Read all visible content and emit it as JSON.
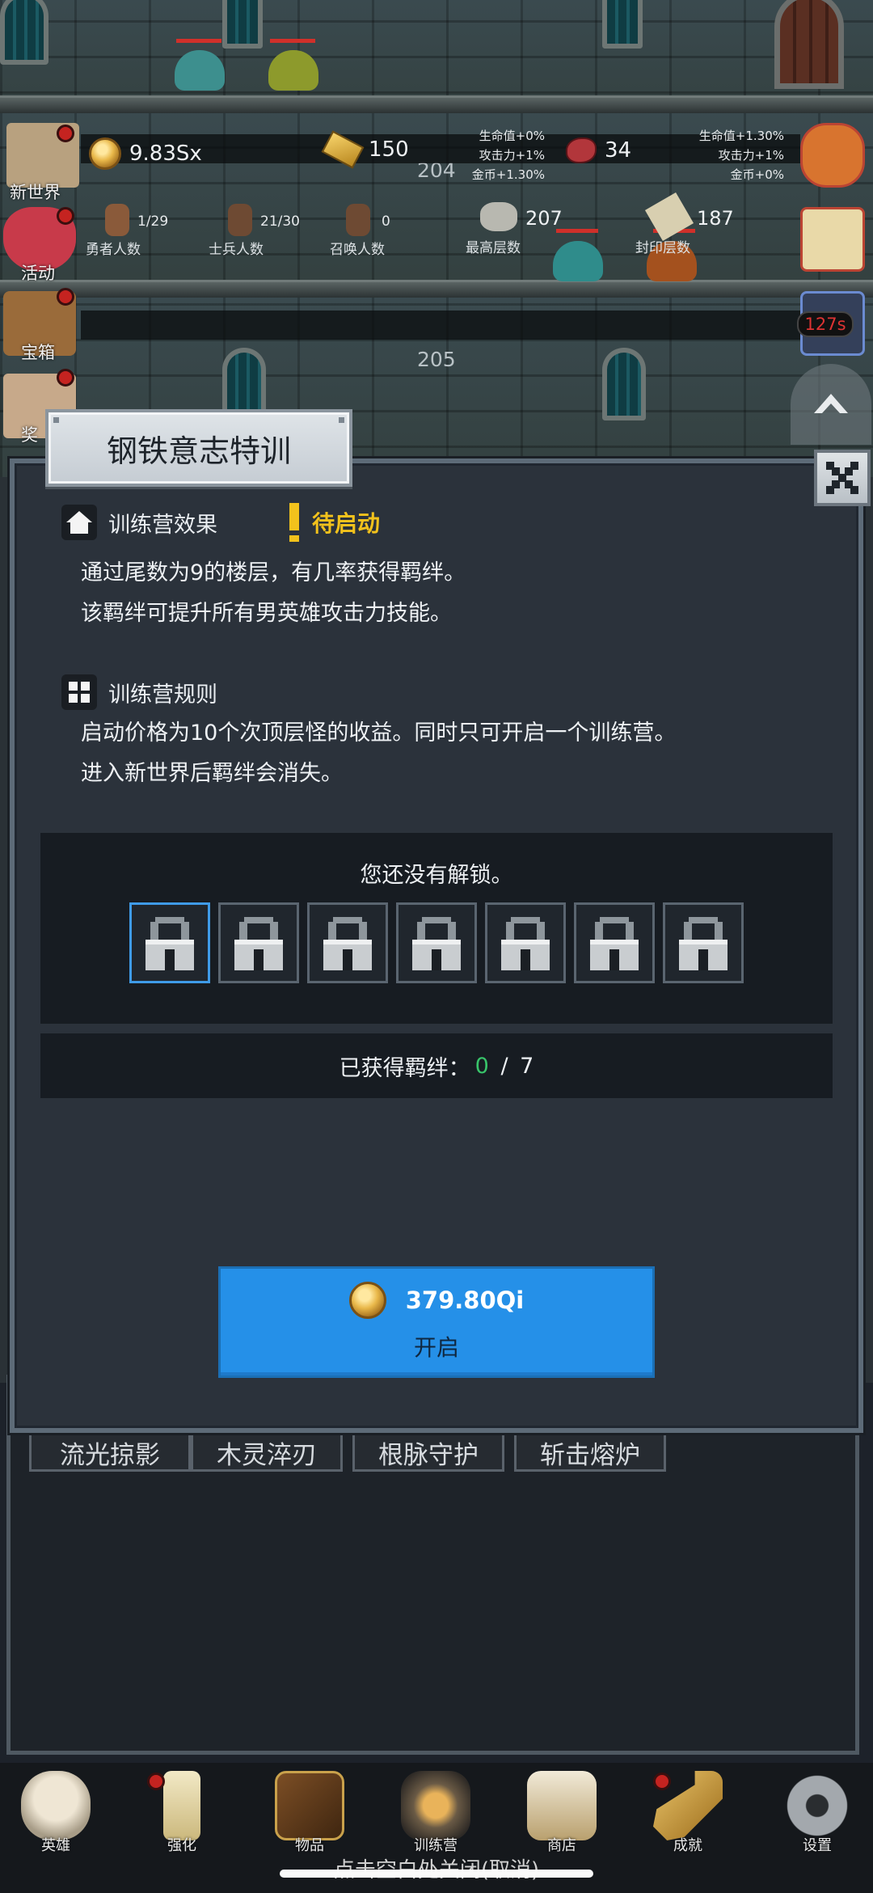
{
  "hud": {
    "coins": "9.83Sx",
    "gold_bars": "150",
    "meat": "34",
    "hero_count": "1/29",
    "hero_count_label": "勇者人数",
    "soldier_count": "21/30",
    "soldier_count_label": "士兵人数",
    "summon_count": "0",
    "summon_count_label": "召唤人数",
    "highest_floor": "207",
    "highest_floor_label": "最高层数",
    "sealed_floor": "187",
    "sealed_floor_label": "封印层数",
    "bonus_left": [
      "生命值+0%",
      "攻击力+1%",
      "金币+1.30%"
    ],
    "bonus_right": [
      "生命值+1.30%",
      "攻击力+1%",
      "金币+0%"
    ],
    "timer": "127s",
    "floor_204": "204",
    "floor_205": "205"
  },
  "side_menu": {
    "new_world": "新世界",
    "events": "活动",
    "treasure": "宝箱",
    "partial": "奖"
  },
  "modal": {
    "title": "钢铁意志特训",
    "effect_heading": "训练营效果",
    "status": "待启动",
    "effect_lines": [
      "通过尾数为9的楼层，有几率获得羁绊。",
      "该羁绊可提升所有男英雄攻击力技能。"
    ],
    "rules_heading": "训练营规则",
    "rules_lines": [
      "启动价格为10个次顶层怪的收益。同时只可开启一个训练营。",
      "进入新世界后羁绊会消失。"
    ],
    "lock_message": "您还没有解锁。",
    "lock_slots": 7,
    "bond_label": "已获得羁绊：",
    "bond_current": "0",
    "bond_sep": " / ",
    "bond_total": "7",
    "price": "379.80Qi",
    "open_label": "开启"
  },
  "skill_tabs": [
    "流光掠影",
    "木灵淬刃",
    "根脉守护",
    "斩击熔炉"
  ],
  "bottom_nav": [
    "英雄",
    "强化",
    "物品",
    "训练营",
    "商店",
    "成就",
    "设置"
  ],
  "close_hint": "点击空白处关闭(取消)",
  "colors": {
    "accent_blue": "#2590e8",
    "status_yellow": "#f2c21c",
    "bond_green": "#38c46a",
    "modal_bg": "#2b323b"
  }
}
